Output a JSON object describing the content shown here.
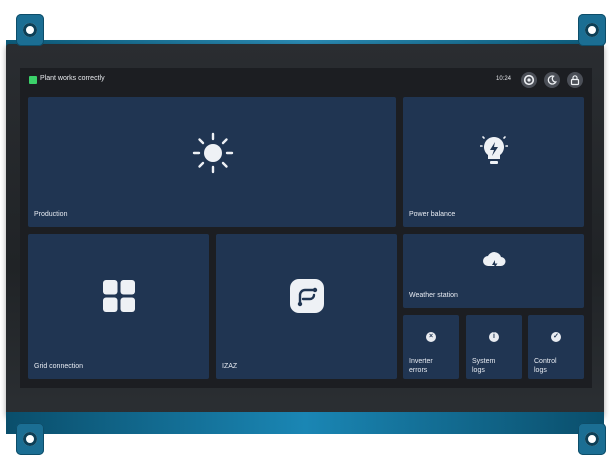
{
  "status": {
    "text": "Plant works correctly",
    "color": "#3bd16a"
  },
  "clock": "10:24",
  "toolbar": {
    "icons": [
      "settings-icon",
      "dark-mode-moon-icon",
      "lock-icon"
    ]
  },
  "tiles": {
    "production": {
      "label": "Production",
      "icon": "sun-icon"
    },
    "power_balance": {
      "label": "Power balance",
      "icon": "lightbulb-bolt-icon"
    },
    "weather_station": {
      "label": "Weather station",
      "icon": "cloud-lightning-icon"
    },
    "grid_connection": {
      "label": "Grid connection",
      "icon": "grid-icon"
    },
    "izaz": {
      "label": "IZAZ",
      "icon": "flow-icon"
    },
    "inverter_errors": {
      "label": "Inverter\nerrors",
      "icon": "x-circle-icon"
    },
    "system_logs": {
      "label": "System\nlogs",
      "icon": "info-icon"
    },
    "control_logs": {
      "label": "Control\nlogs",
      "icon": "check-circle-icon"
    }
  },
  "colors": {
    "tile_bg": "#203552",
    "screen_bg": "#1c1e22",
    "pcb": "#1b6e93"
  }
}
